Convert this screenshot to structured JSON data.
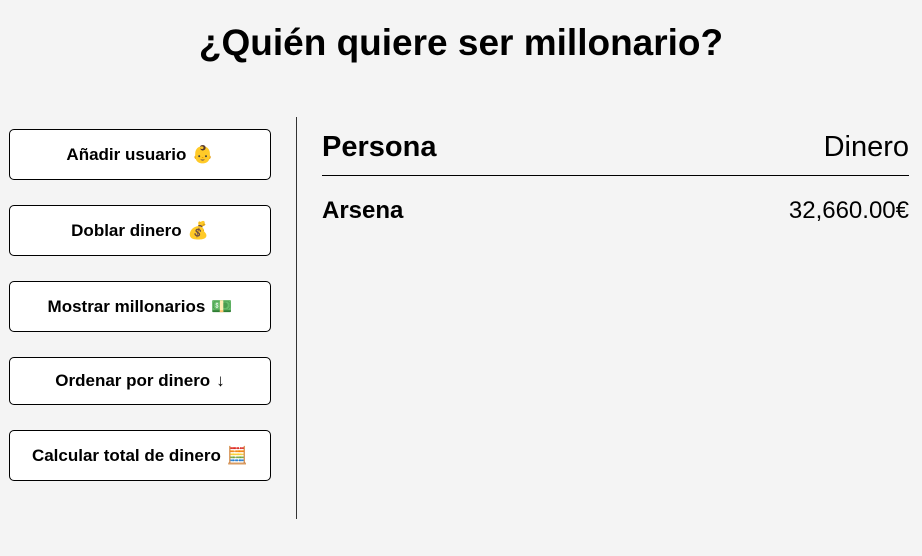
{
  "page": {
    "title": "¿Quién quiere ser millonario?"
  },
  "sidebar": {
    "buttons": [
      {
        "label": "Añadir usuario",
        "emoji": "👶"
      },
      {
        "label": "Doblar dinero",
        "emoji": "💰"
      },
      {
        "label": "Mostrar millonarios",
        "emoji": "💵"
      },
      {
        "label": "Ordenar por dinero",
        "emoji": "↓"
      },
      {
        "label": "Calcular total de dinero",
        "emoji": "🧮"
      }
    ]
  },
  "table": {
    "headers": {
      "person": "Persona",
      "money": "Dinero"
    },
    "rows": [
      {
        "person": "Arsena",
        "money": "32,660.00€"
      }
    ]
  }
}
